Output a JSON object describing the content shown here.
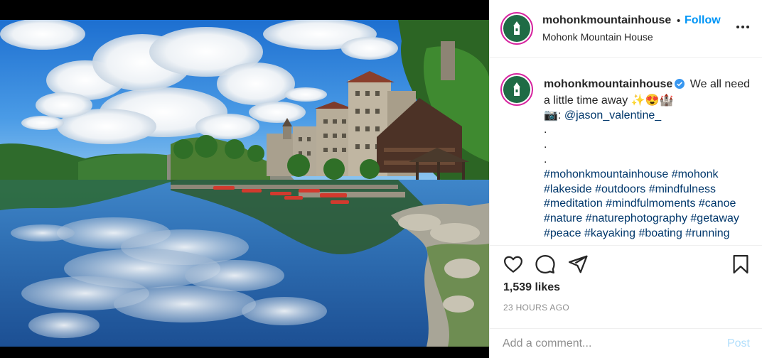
{
  "account": {
    "username": "mohonkmountainhouse",
    "separator": "•",
    "follow_label": "Follow",
    "location": "Mohonk Mountain House",
    "avatar_color": "#1f6b45"
  },
  "caption": {
    "text": "We all need a little time away ✨😍🏰",
    "credit_emoji": "📷:",
    "credit_handle": "@jason_valentine_",
    "dots": [
      ".",
      ".",
      "."
    ],
    "hashtags": [
      "#mohonkmountainhouse",
      "#mohonk",
      "#lakeside",
      "#outdoors",
      "#mindfulness",
      "#meditation",
      "#mindfulmoments",
      "#canoe",
      "#nature",
      "#naturephotography",
      "#getaway",
      "#peace",
      "#kayaking",
      "#boating",
      "#running"
    ]
  },
  "stats": {
    "likes": "1,539 likes",
    "time_ago": "23 HOURS AGO"
  },
  "comment": {
    "placeholder": "Add a comment...",
    "post_label": "Post"
  },
  "icons": {
    "like": "heart-icon",
    "comment": "comment-icon",
    "share": "paper-plane-icon",
    "save": "bookmark-icon",
    "more": "more-options-icon",
    "verified": "verified-badge-icon"
  },
  "colors": {
    "link": "#0095f6",
    "hashtag": "#00376b",
    "muted": "#8e8e8e",
    "post_disabled": "#b2dffc"
  }
}
